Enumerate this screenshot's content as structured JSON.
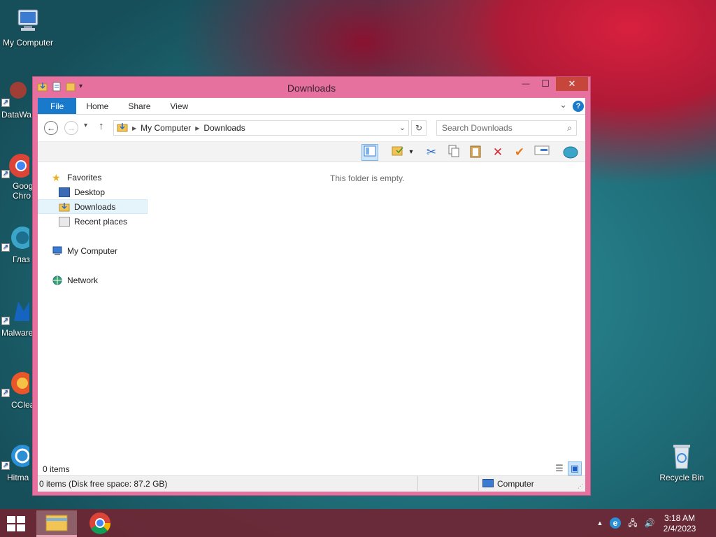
{
  "desktop": {
    "icons": [
      {
        "label": "My Computer"
      },
      {
        "label": "DataWa"
      },
      {
        "label": "Goog Chro"
      },
      {
        "label": "Глаз"
      },
      {
        "label": "Malware"
      },
      {
        "label": "CClea"
      },
      {
        "label": "Hitma"
      },
      {
        "label": "Recycle Bin"
      }
    ]
  },
  "window": {
    "title": "Downloads",
    "controls": {
      "minimize": "—",
      "maximize": "☐",
      "close": "✕"
    },
    "ribbon": {
      "tabs": [
        "File",
        "Home",
        "Share",
        "View"
      ],
      "help": "?"
    },
    "address": {
      "crumbs": [
        "My Computer",
        "Downloads"
      ],
      "search_placeholder": "Search Downloads"
    },
    "navpane": {
      "favorites": "Favorites",
      "desktop": "Desktop",
      "downloads": "Downloads",
      "recent": "Recent places",
      "my_computer": "My Computer",
      "network": "Network"
    },
    "content": {
      "empty_text": "This folder is empty."
    },
    "status": {
      "items": "0 items",
      "details": "0 items (Disk free space: 87.2 GB)",
      "location": "Computer"
    }
  },
  "taskbar": {
    "time": "3:18 AM",
    "date": "2/4/2023"
  },
  "colors": {
    "window_frame": "#e6709e",
    "accent": "#1979ca",
    "taskbar": "#702634"
  }
}
